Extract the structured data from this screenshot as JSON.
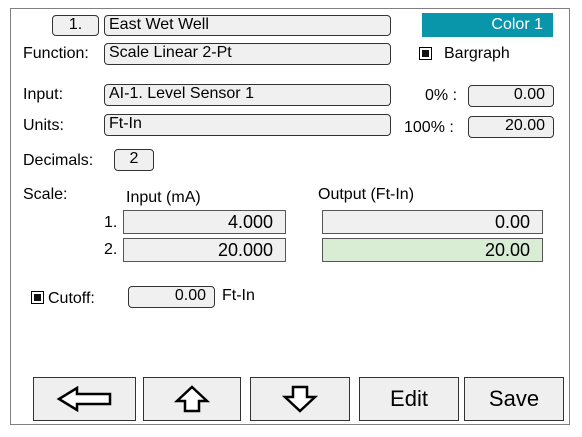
{
  "header": {
    "number_label": "1.",
    "name": "East Wet Well",
    "color_label": "Color 1",
    "color": "#0a96aa"
  },
  "function": {
    "label": "Function:",
    "value": "Scale Linear 2-Pt"
  },
  "bargraph": {
    "label": "Bargraph",
    "checked": true
  },
  "input": {
    "label": "Input:",
    "value": "AI-1. Level Sensor 1"
  },
  "units": {
    "label": "Units:",
    "value": "Ft-In"
  },
  "range": {
    "zero_label": "0% :",
    "zero_value": "0.00",
    "full_label": "100% :",
    "full_value": "20.00"
  },
  "decimals": {
    "label": "Decimals:",
    "value": "2"
  },
  "scale": {
    "label": "Scale:",
    "input_header": "Input (mA)",
    "output_header": "Output (Ft-In)",
    "rows": [
      {
        "index": "1.",
        "input": "4.000",
        "output": "0.00"
      },
      {
        "index": "2.",
        "input": "20.000",
        "output": "20.00"
      }
    ]
  },
  "cutoff": {
    "label": "Cutoff:",
    "value": "0.00",
    "unit": "Ft-In",
    "checked": true
  },
  "buttons": {
    "back_icon": "left-arrow-icon",
    "up_icon": "up-arrow-icon",
    "down_icon": "down-arrow-icon",
    "edit_label": "Edit",
    "save_label": "Save"
  }
}
